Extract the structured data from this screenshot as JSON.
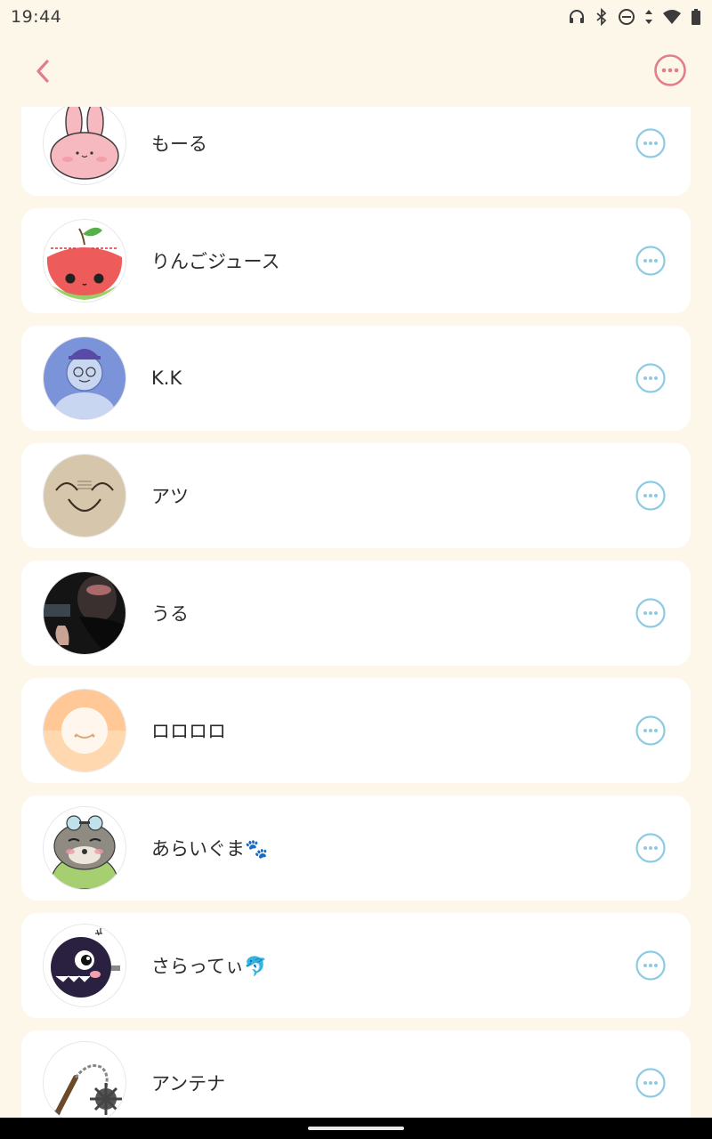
{
  "status_bar": {
    "time": "19:44",
    "icons": [
      "headphones-icon",
      "bluetooth-icon",
      "do-not-disturb-icon",
      "data-arrows-icon",
      "wifi-icon",
      "battery-icon"
    ]
  },
  "header": {
    "back_icon": "chevron-left-icon",
    "more_icon": "more-horizontal-circle-icon",
    "accent_color": "#e07e8a"
  },
  "contacts": [
    {
      "name": "もーる",
      "avatar": "pink-rabbit"
    },
    {
      "name": "りんごジュース",
      "avatar": "apple-juice"
    },
    {
      "name": "K.K",
      "avatar": "blue-person-cap-k"
    },
    {
      "name": "アツ",
      "avatar": "smiling-face-sketch"
    },
    {
      "name": "うる",
      "avatar": "dark-photo"
    },
    {
      "name": "ロロロロ",
      "avatar": "peach-smile"
    },
    {
      "name": "あらいぐま🐾",
      "avatar": "raccoon-goggles"
    },
    {
      "name": "さらってぃ🐬",
      "avatar": "chomp-ball"
    },
    {
      "name": "アンテナ",
      "avatar": "flail-weapon"
    }
  ],
  "colors": {
    "background": "#fdf7ea",
    "card": "#ffffff",
    "row_more_icon": "#8ccbe3",
    "header_icon": "#e07e8a"
  }
}
